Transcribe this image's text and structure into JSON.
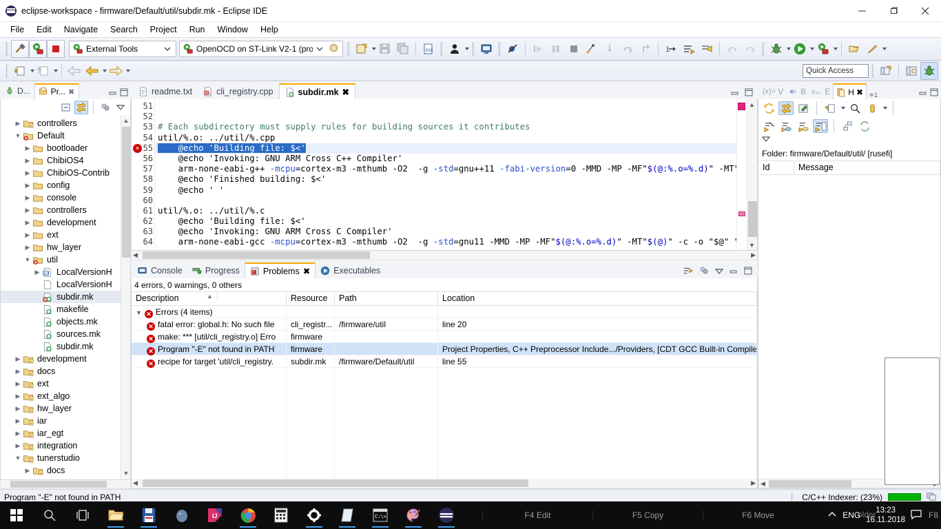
{
  "window": {
    "title": "eclipse-workspace - firmware/Default/util/subdir.mk - Eclipse IDE",
    "minimize_label": "Minimize",
    "maximize_label": "Restore",
    "close_label": "Close"
  },
  "menubar": {
    "items": [
      "File",
      "Edit",
      "Navigate",
      "Search",
      "Project",
      "Run",
      "Window",
      "Help"
    ]
  },
  "toolbar1": {
    "build_label": "Build",
    "external_tools_run_label": "Run External Tool",
    "terminate_label": "Terminate",
    "external_tools_combo": "External Tools",
    "debug_combo": "OpenOCD on ST-Link V2-1 (promp",
    "settings_label": "Settings",
    "new_label": "New",
    "save_label": "Save",
    "save_all_label": "Save All",
    "hex_label": "Open Hex Editor",
    "person_label": "User",
    "console_label": "Open Console",
    "skip_breakpoints_label": "Skip All Breakpoints",
    "resume_label": "Resume",
    "suspend_label": "Suspend",
    "stop_label": "Terminate",
    "disconnect_label": "Disconnect",
    "step_into_label": "Step Into",
    "step_over_label": "Step Over",
    "step_return_label": "Step Return",
    "instruction_stepping_label": "Instruction Stepping Mode",
    "next_instruction_label": "Next Instruction",
    "restart_label": "Restart",
    "debug_label": "Debug",
    "run_label": "Run",
    "run_external_label": "Run External Tools",
    "open_type_label": "Open Type",
    "search_label": "Search"
  },
  "toolbar2": {
    "back_label": "Back",
    "forward_label": "Forward",
    "previous_label": "Previous Annotation",
    "next_label": "Next Annotation",
    "last_edit_label": "Last Edit Location",
    "quick_access_placeholder": "Quick Access",
    "perspective_new_label": "Open Perspective",
    "perspective_cpp_label": "C/C++",
    "perspective_debug_label": "Debug"
  },
  "left_panel": {
    "tabs": [
      {
        "label": "D...",
        "icon": "debug-icon",
        "selected": false,
        "closable": false
      },
      {
        "label": "Pr...",
        "icon": "project-explorer-icon",
        "selected": true,
        "closable": true
      }
    ],
    "view_toolbar": [
      {
        "name": "collapse-all-icon"
      },
      {
        "name": "link-with-editor-icon",
        "active": true
      },
      {
        "name": "filter-icon"
      },
      {
        "name": "view-menu-icon"
      }
    ],
    "tree": [
      {
        "label": "controllers",
        "indent": 1,
        "twist": "collapsed",
        "icon": "folder-link",
        "selected": false
      },
      {
        "label": "Default",
        "indent": 1,
        "twist": "expanded",
        "icon": "folder-err",
        "selected": false
      },
      {
        "label": "bootloader",
        "indent": 2,
        "twist": "collapsed",
        "icon": "folder",
        "selected": false
      },
      {
        "label": "ChibiOS4",
        "indent": 2,
        "twist": "collapsed",
        "icon": "folder",
        "selected": false
      },
      {
        "label": "ChibiOS-Contrib",
        "indent": 2,
        "twist": "collapsed",
        "icon": "folder",
        "selected": false
      },
      {
        "label": "config",
        "indent": 2,
        "twist": "collapsed",
        "icon": "folder",
        "selected": false
      },
      {
        "label": "console",
        "indent": 2,
        "twist": "collapsed",
        "icon": "folder",
        "selected": false
      },
      {
        "label": "controllers",
        "indent": 2,
        "twist": "collapsed",
        "icon": "folder",
        "selected": false
      },
      {
        "label": "development",
        "indent": 2,
        "twist": "collapsed",
        "icon": "folder",
        "selected": false
      },
      {
        "label": "ext",
        "indent": 2,
        "twist": "collapsed",
        "icon": "folder",
        "selected": false
      },
      {
        "label": "hw_layer",
        "indent": 2,
        "twist": "collapsed",
        "icon": "folder",
        "selected": false
      },
      {
        "label": "util",
        "indent": 2,
        "twist": "expanded",
        "icon": "folder-err",
        "selected": false
      },
      {
        "label": "LocalVersionH",
        "indent": 3,
        "twist": "collapsed",
        "icon": "file-bin",
        "selected": false
      },
      {
        "label": "LocalVersionH",
        "indent": 3,
        "twist": "none",
        "icon": "file",
        "selected": false
      },
      {
        "label": "subdir.mk",
        "indent": 3,
        "twist": "none",
        "icon": "file-mk-err",
        "selected": true
      },
      {
        "label": "makefile",
        "indent": 3,
        "twist": "none",
        "icon": "file-mk",
        "selected": false
      },
      {
        "label": "objects.mk",
        "indent": 3,
        "twist": "none",
        "icon": "file-mk",
        "selected": false
      },
      {
        "label": "sources.mk",
        "indent": 3,
        "twist": "none",
        "icon": "file-mk",
        "selected": false
      },
      {
        "label": "subdir.mk",
        "indent": 3,
        "twist": "none",
        "icon": "file-mk",
        "selected": false
      },
      {
        "label": "development",
        "indent": 1,
        "twist": "collapsed",
        "icon": "folder-link",
        "selected": false
      },
      {
        "label": "docs",
        "indent": 1,
        "twist": "collapsed",
        "icon": "folder-link",
        "selected": false
      },
      {
        "label": "ext",
        "indent": 1,
        "twist": "collapsed",
        "icon": "folder-link",
        "selected": false
      },
      {
        "label": "ext_algo",
        "indent": 1,
        "twist": "collapsed",
        "icon": "folder-link",
        "selected": false
      },
      {
        "label": "hw_layer",
        "indent": 1,
        "twist": "collapsed",
        "icon": "folder-link",
        "selected": false
      },
      {
        "label": "iar",
        "indent": 1,
        "twist": "collapsed",
        "icon": "folder-link",
        "selected": false
      },
      {
        "label": "iar_egt",
        "indent": 1,
        "twist": "collapsed",
        "icon": "folder-link",
        "selected": false
      },
      {
        "label": "integration",
        "indent": 1,
        "twist": "collapsed",
        "icon": "folder-link",
        "selected": false
      },
      {
        "label": "tunerstudio",
        "indent": 1,
        "twist": "expanded",
        "icon": "folder-link",
        "selected": false
      },
      {
        "label": "docs",
        "indent": 2,
        "twist": "collapsed",
        "icon": "folder-link",
        "selected": false
      }
    ]
  },
  "editor": {
    "tabs": [
      {
        "label": "readme.txt",
        "icon": "text-file-icon",
        "selected": false,
        "closable": false
      },
      {
        "label": "cli_registry.cpp",
        "icon": "cpp-file-icon",
        "selected": false,
        "closable": false
      },
      {
        "label": "subdir.mk",
        "icon": "makefile-icon",
        "selected": true,
        "closable": true
      }
    ],
    "minimize_label": "Minimize",
    "maximize_label": "Maximize",
    "first_line": 51,
    "lines": [
      {
        "num": 51,
        "text": ""
      },
      {
        "num": 52,
        "text": ""
      },
      {
        "num": 53,
        "text": "# Each subdirectory must supply rules for building sources it contributes",
        "style": "comment"
      },
      {
        "num": 54,
        "text": "util/%.o: ../util/%.cpp"
      },
      {
        "num": 55,
        "text": "\t@echo 'Building file: $<'",
        "error": true,
        "selected": true
      },
      {
        "num": 56,
        "text": "\t@echo 'Invoking: GNU ARM Cross C++ Compiler'"
      },
      {
        "num": 57,
        "text": "\tarm-none-eabi-g++ -mcpu=cortex-m3 -mthumb -O2  -g -std=gnu++11 -fabi-version=0 -MMD -MP -MF\"$(@:%.o=%.d)\" -MT\"$(@)\" -"
      },
      {
        "num": 58,
        "text": "\t@echo 'Finished building: $<'"
      },
      {
        "num": 59,
        "text": "\t@echo ' '"
      },
      {
        "num": 60,
        "text": ""
      },
      {
        "num": 61,
        "text": "util/%.o: ../util/%.c"
      },
      {
        "num": 62,
        "text": "\t@echo 'Building file: $<'"
      },
      {
        "num": 63,
        "text": "\t@echo 'Invoking: GNU ARM Cross C Compiler'"
      },
      {
        "num": 64,
        "text": "\tarm-none-eabi-gcc -mcpu=cortex-m3 -mthumb -O2  -g -std=gnu11 -MMD -MP -MF\"$(@:%.o=%.d)\" -MT\"$(@)\" -c -o \"$@\" \"$<\""
      }
    ]
  },
  "problems": {
    "tabs": [
      {
        "label": "Console",
        "icon": "console-icon",
        "selected": false,
        "closable": false
      },
      {
        "label": "Progress",
        "icon": "progress-icon",
        "selected": false,
        "closable": false
      },
      {
        "label": "Problems",
        "icon": "problems-icon",
        "selected": true,
        "closable": true
      },
      {
        "label": "Executables",
        "icon": "executables-icon",
        "selected": false,
        "closable": false
      }
    ],
    "summary": "4 errors, 0 warnings, 0 others",
    "columns": [
      "Description",
      "Resource",
      "Path",
      "Location"
    ],
    "group": {
      "label": "Errors (4 items)",
      "expanded": true
    },
    "rows": [
      {
        "description": "fatal error: global.h: No such file",
        "resource": "cli_registr...",
        "path": "/firmware/util",
        "location": "line 20",
        "selected": false
      },
      {
        "description": "make: *** [util/cli_registry.o] Erro",
        "resource": "firmware",
        "path": "",
        "location": "",
        "selected": false
      },
      {
        "description": "Program \"-E\" not found in PATH",
        "resource": "firmware",
        "path": "",
        "location": "Project Properties, C++ Preprocessor Include.../Providers, [CDT GCC Built-in Compiler",
        "selected": true
      },
      {
        "description": "recipe for target 'util/cli_registry.",
        "resource": "subdir.mk",
        "path": "/firmware/Default/util",
        "location": "line 55",
        "selected": false
      }
    ],
    "toolbar": [
      {
        "name": "focus-on-selection-icon"
      },
      {
        "name": "filters-icon"
      },
      {
        "name": "view-menu-icon"
      },
      {
        "name": "minimize-icon"
      },
      {
        "name": "maximize-icon"
      }
    ]
  },
  "right_panel": {
    "tabs": [
      {
        "label": "V",
        "icon": "variables-icon",
        "selected": false
      },
      {
        "label": "B",
        "icon": "breakpoints-icon",
        "selected": false
      },
      {
        "label": "E",
        "icon": "expressions-icon",
        "selected": false
      },
      {
        "label": "H",
        "icon": "history-icon",
        "selected": true,
        "closable": true
      }
    ],
    "overflow_label": "1",
    "folder_label": "Folder: firmware/Default/util/ [rusefi]",
    "columns": [
      "Id",
      "Message"
    ],
    "rows": [],
    "toolbar_row1": [
      {
        "name": "refresh-icon"
      },
      {
        "name": "link-with-editor-icon",
        "active": true
      },
      {
        "name": "pin-icon"
      },
      {
        "name": "compare-mode-icon"
      },
      {
        "name": "search-icon"
      },
      {
        "name": "filter-icon"
      }
    ],
    "toolbar_row2": [
      {
        "name": "collapse-all-icon"
      },
      {
        "name": "incoming-mode-icon"
      },
      {
        "name": "outgoing-mode-icon"
      },
      {
        "name": "flat-layout-icon",
        "active": true
      },
      {
        "name": "tree-layout-icon"
      },
      {
        "name": "synchronize-icon"
      }
    ]
  },
  "statusbar": {
    "message": "Program \"-E\" not found in PATH",
    "indexer": "C/C++ Indexer: (23%)",
    "progress_percent": 23
  },
  "taskbar": {
    "icons": [
      {
        "name": "windows-start-icon",
        "running": false
      },
      {
        "name": "search-icon",
        "running": false
      },
      {
        "name": "task-view-icon",
        "running": false
      },
      {
        "name": "file-explorer-icon",
        "running": true
      },
      {
        "name": "floppy-save-icon",
        "running": true
      },
      {
        "name": "postgresql-icon",
        "running": false
      },
      {
        "name": "intellij-idea-icon",
        "running": false
      },
      {
        "name": "chrome-icon",
        "running": true
      },
      {
        "name": "calculator-icon",
        "running": false
      },
      {
        "name": "settings-gear-icon",
        "running": true
      },
      {
        "name": "notepad-icon",
        "running": true
      },
      {
        "name": "terminal-icon",
        "running": true
      },
      {
        "name": "paint-icon",
        "running": true
      },
      {
        "name": "eclipse-icon",
        "running": true
      }
    ],
    "fkeys": [
      "F4 Edit",
      "F5 Copy",
      "F6 Move"
    ],
    "ghost_label": "older",
    "f8_label": "F8",
    "language": "ENG",
    "time": "13:23",
    "date": "16.11.2018"
  }
}
